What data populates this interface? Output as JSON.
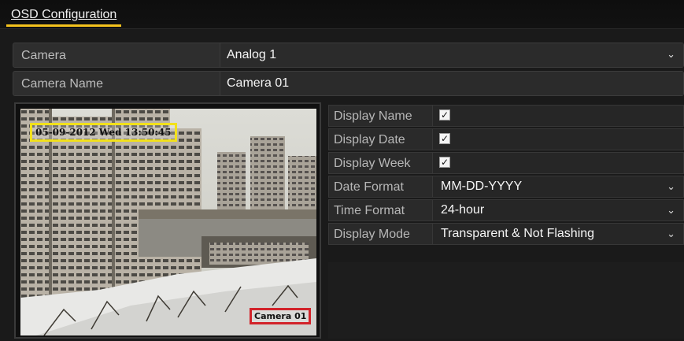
{
  "title": {
    "tab_label": "OSD Configuration"
  },
  "camera": {
    "label": "Camera",
    "value": "Analog 1"
  },
  "camera_name": {
    "label": "Camera Name",
    "value": "Camera 01"
  },
  "preview": {
    "osd_date_text": "05-09-2012 Wed 13:50:45",
    "osd_camera_name_text": "Camera 01"
  },
  "settings": {
    "display_name": {
      "label": "Display Name",
      "checked": true
    },
    "display_date": {
      "label": "Display Date",
      "checked": true
    },
    "display_week": {
      "label": "Display Week",
      "checked": true
    },
    "date_format": {
      "label": "Date Format",
      "value": "MM-DD-YYYY"
    },
    "time_format": {
      "label": "Time Format",
      "value": "24-hour"
    },
    "display_mode": {
      "label": "Display Mode",
      "value": "Transparent & Not Flashing"
    }
  },
  "icons": {
    "dropdown": "chevron-down-icon",
    "check": "checkmark-icon"
  },
  "colors": {
    "accent_tab": "#f4c21d",
    "osd_date_box": "#f2e11a",
    "osd_name_box": "#d2232a"
  }
}
